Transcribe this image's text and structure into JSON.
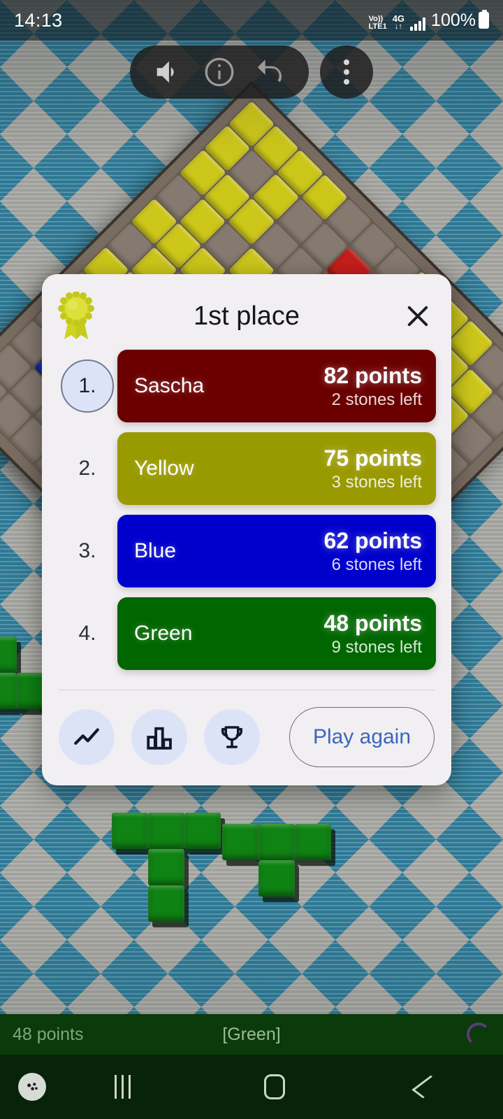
{
  "status_bar": {
    "time": "14:13",
    "volte_top": "Vo))",
    "volte_bottom": "LTE1",
    "network": "4G",
    "network_arrows": "↓↑",
    "battery": "100%"
  },
  "toolbar": {
    "sound_icon": "volume-icon",
    "info_icon": "info-icon",
    "undo_icon": "undo-icon",
    "menu_icon": "more-vertical-icon"
  },
  "dialog": {
    "award_icon": "award-ribbon-icon",
    "title": "1st place",
    "close_icon": "close-icon",
    "rows": [
      {
        "rank": "1.",
        "name": "Sascha",
        "points": "82 points",
        "stones": "2 stones left",
        "color": "#6b0000",
        "text_color": "#ffffff"
      },
      {
        "rank": "2.",
        "name": "Yellow",
        "points": "75 points",
        "stones": "3 stones left",
        "color": "#999900",
        "text_color": "#ffffff"
      },
      {
        "rank": "3.",
        "name": "Blue",
        "points": "62 points",
        "stones": "6 stones left",
        "color": "#0000cc",
        "text_color": "#ffffff"
      },
      {
        "rank": "4.",
        "name": "Green",
        "points": "48 points",
        "stones": "9 stones left",
        "color": "#006600",
        "text_color": "#ffffff"
      }
    ],
    "footer": {
      "stats_line_icon": "line-chart-icon",
      "stats_bar_icon": "bar-chart-icon",
      "trophy_icon": "trophy-icon",
      "play_again_label": "Play again"
    }
  },
  "game_status": {
    "points": "48 points",
    "current_player": "[Green]",
    "spinner_icon": "loading-spinner-icon"
  },
  "nav_bar": {
    "game_tools_icon": "game-controller-icon",
    "recents_icon": "recents-icon",
    "home_icon": "home-icon",
    "back_icon": "back-icon"
  },
  "colors": {
    "dialog_bg": "#f2eff2",
    "accent_blue": "#3a66bf",
    "icon_circle": "#dde3f7",
    "rank_circle_border": "#6d7b93",
    "status_bar_bg": "#0b3a0b",
    "nav_bar_bg": "#07230a",
    "board_wood": "#7e7064"
  }
}
